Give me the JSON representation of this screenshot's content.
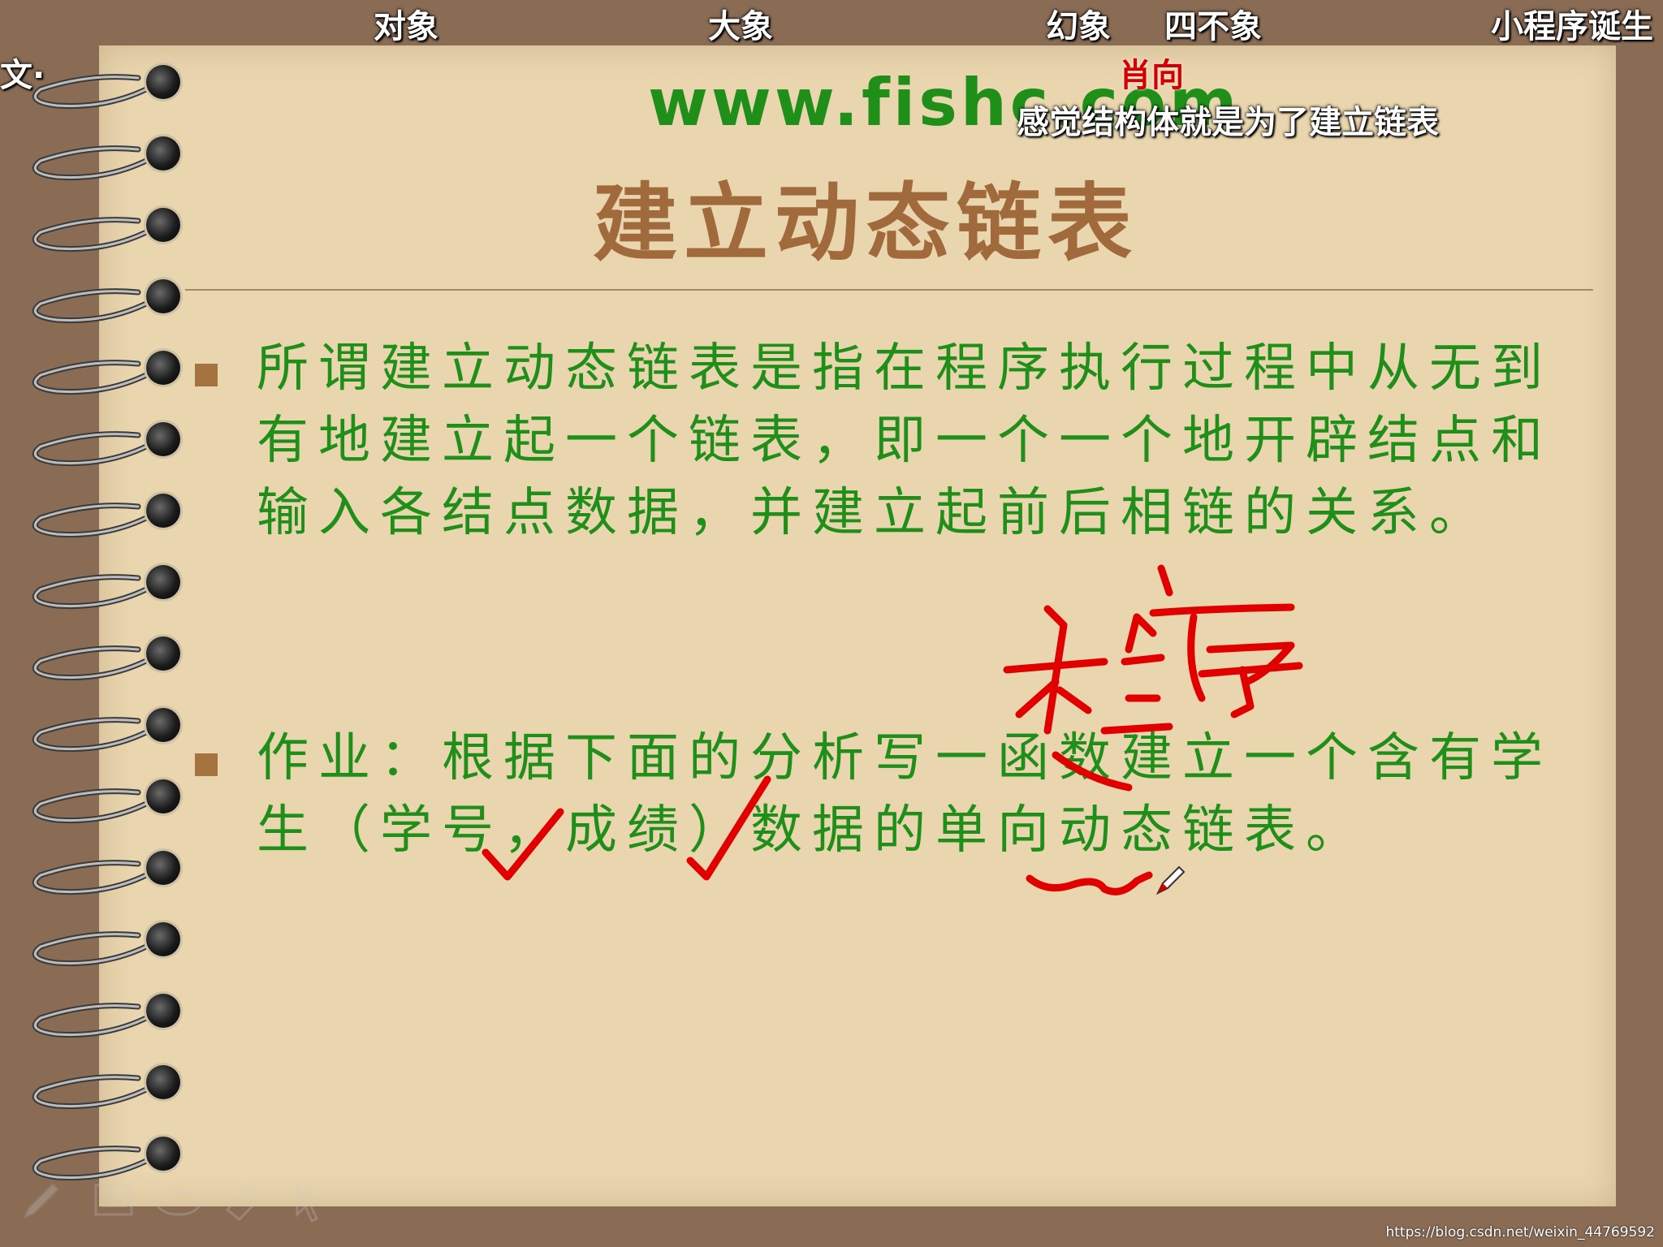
{
  "danmaku": {
    "d1": "对象",
    "d2": "大象",
    "d3": "幻象",
    "d4": "四不象",
    "d5": "小程序诞生",
    "d6": "文·",
    "d7": "肖向",
    "d8": "感觉结构体就是为了建立链表"
  },
  "slide": {
    "site": "www.fishc.com",
    "title": "建立动态链表",
    "paragraph1": "所谓建立动态链表是指在程序执行过程中从无到有地建立起一个链表，即一个一个地开辟结点和输入各结点数据，并建立起前后相链的关系。",
    "paragraph2": "作业：根据下面的分析写一函数建立一个含有学生（学号，成绩）数据的单向动态链表。"
  },
  "annotations": {
    "handwritten": "程序"
  },
  "toolbar": {
    "items": [
      "pen-icon",
      "screen-icon",
      "eraser-icon",
      "highlighter-icon",
      "arrow-icon"
    ]
  },
  "watermark": "https://blog.csdn.net/weixin_44769592",
  "colors": {
    "paper": "#e9d5ae",
    "frame": "#8a6c55",
    "text_green": "#1f8f1a",
    "title_brown": "#a06a3c",
    "ink_red": "#e00000"
  }
}
